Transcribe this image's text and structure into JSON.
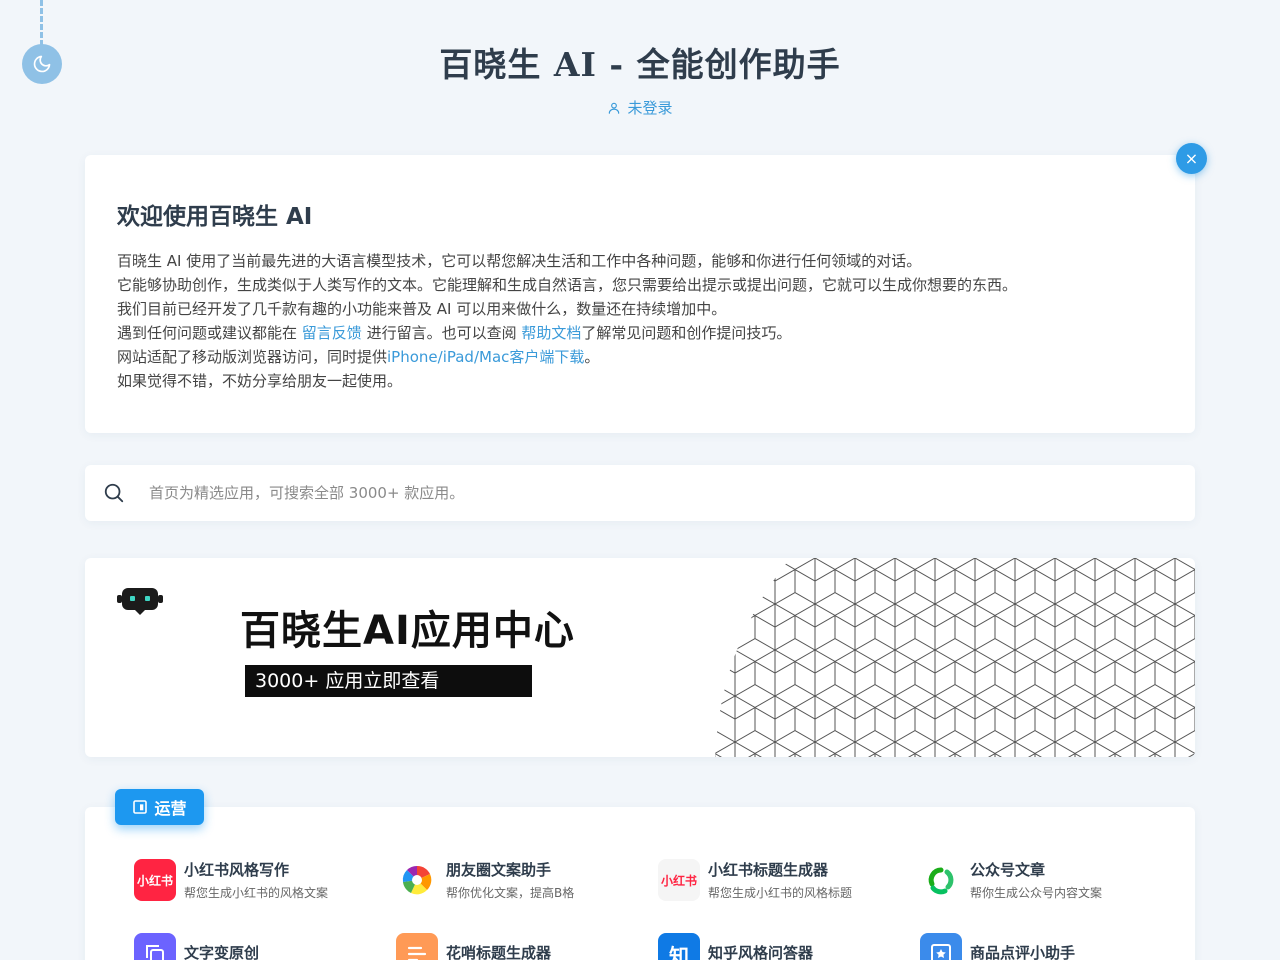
{
  "header": {
    "title": "百晓生 AI - 全能创作助手",
    "login_status": "未登录"
  },
  "welcome": {
    "title": "欢迎使用百晓生 AI",
    "line1": "百晓生 AI 使用了当前最先进的大语言模型技术，它可以帮您解决生活和工作中各种问题，能够和你进行任何领域的对话。",
    "line2": "它能够协助创作，生成类似于人类写作的文本。它能理解和生成自然语言，您只需要给出提示或提出问题，它就可以生成你想要的东西。",
    "line3": "我们目前已经开发了几千款有趣的小功能来普及 AI 可以用来做什么，数量还在持续增加中。",
    "line4_prefix": "遇到任何问题或建议都能在 ",
    "feedback_link": "留言反馈",
    "line4_middle": " 进行留言。也可以查阅 ",
    "help_link": "帮助文档",
    "line4_suffix": "了解常见问题和创作提问技巧。",
    "line5_prefix": "网站适配了移动版浏览器访问，同时提供",
    "download_link": "iPhone/iPad/Mac客户端下载",
    "line5_suffix": "。",
    "line6": "如果觉得不错，不妨分享给朋友一起使用。",
    "close_label": "×"
  },
  "search": {
    "placeholder": "首页为精选应用，可搜索全部 3000+ 款应用。"
  },
  "banner": {
    "title": "百晓生AI应用中心",
    "subtitle": "3000+ 应用立即查看"
  },
  "category": {
    "label": "运营",
    "apps": [
      {
        "name": "小红书风格写作",
        "desc": "帮您生成小红书的风格文案",
        "icon": "xiaohongshu-icon",
        "icon_text": "小红书",
        "color": "#ff2442"
      },
      {
        "name": "朋友圈文案助手",
        "desc": "帮你优化文案，提高B格",
        "icon": "moments-icon",
        "color": "#ffffff"
      },
      {
        "name": "小红书标题生成器",
        "desc": "帮您生成小红书的风格标题",
        "icon": "xiaohongshu-title-icon",
        "icon_text": "小红书",
        "color": "#f5f5f5"
      },
      {
        "name": "公众号文章",
        "desc": "帮你生成公众号内容文案",
        "icon": "wechat-official-icon",
        "color": "#ffffff"
      },
      {
        "name": "文字变原创",
        "desc": "",
        "icon": "copy-icon",
        "color": "#6c63ff"
      },
      {
        "name": "花哨标题生成器",
        "desc": "",
        "icon": "title-icon",
        "color": "#ff9a56"
      },
      {
        "name": "知乎风格问答器",
        "desc": "",
        "icon": "zhihu-icon",
        "icon_text": "知",
        "color": "#0f7ae5"
      },
      {
        "name": "商品点评小助手",
        "desc": "",
        "icon": "review-icon",
        "color": "#3b8beb"
      }
    ]
  },
  "colors": {
    "accent": "#2e9be6",
    "title": "#2f3d4c",
    "background": "#f2f6fa"
  }
}
